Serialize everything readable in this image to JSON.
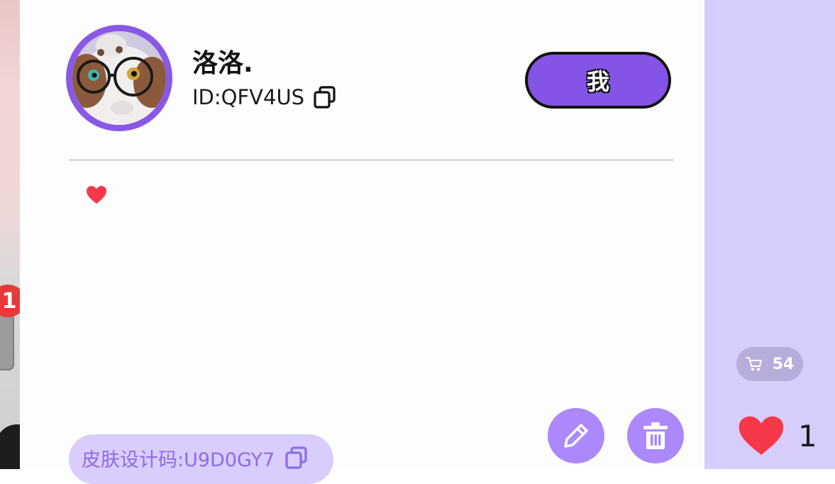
{
  "notification": {
    "count": "1"
  },
  "profile": {
    "name": "洛洛.",
    "id_text": "ID:QFV4US",
    "me_button": "我"
  },
  "skin": {
    "code_text": "皮肤设计码:U9D0GY7"
  },
  "stats": {
    "cart_count": "54",
    "like_count": "1"
  },
  "colors": {
    "accent": "#8454e6",
    "avatar_ring": "#8a58e6",
    "button_light": "#ab88fb",
    "panel": "#d7cdfd",
    "heart": "#f5384a",
    "badge_red": "#e63a3a"
  },
  "icons": [
    "copy-icon",
    "heart-icon",
    "pencil-icon",
    "trash-icon",
    "cart-icon"
  ]
}
